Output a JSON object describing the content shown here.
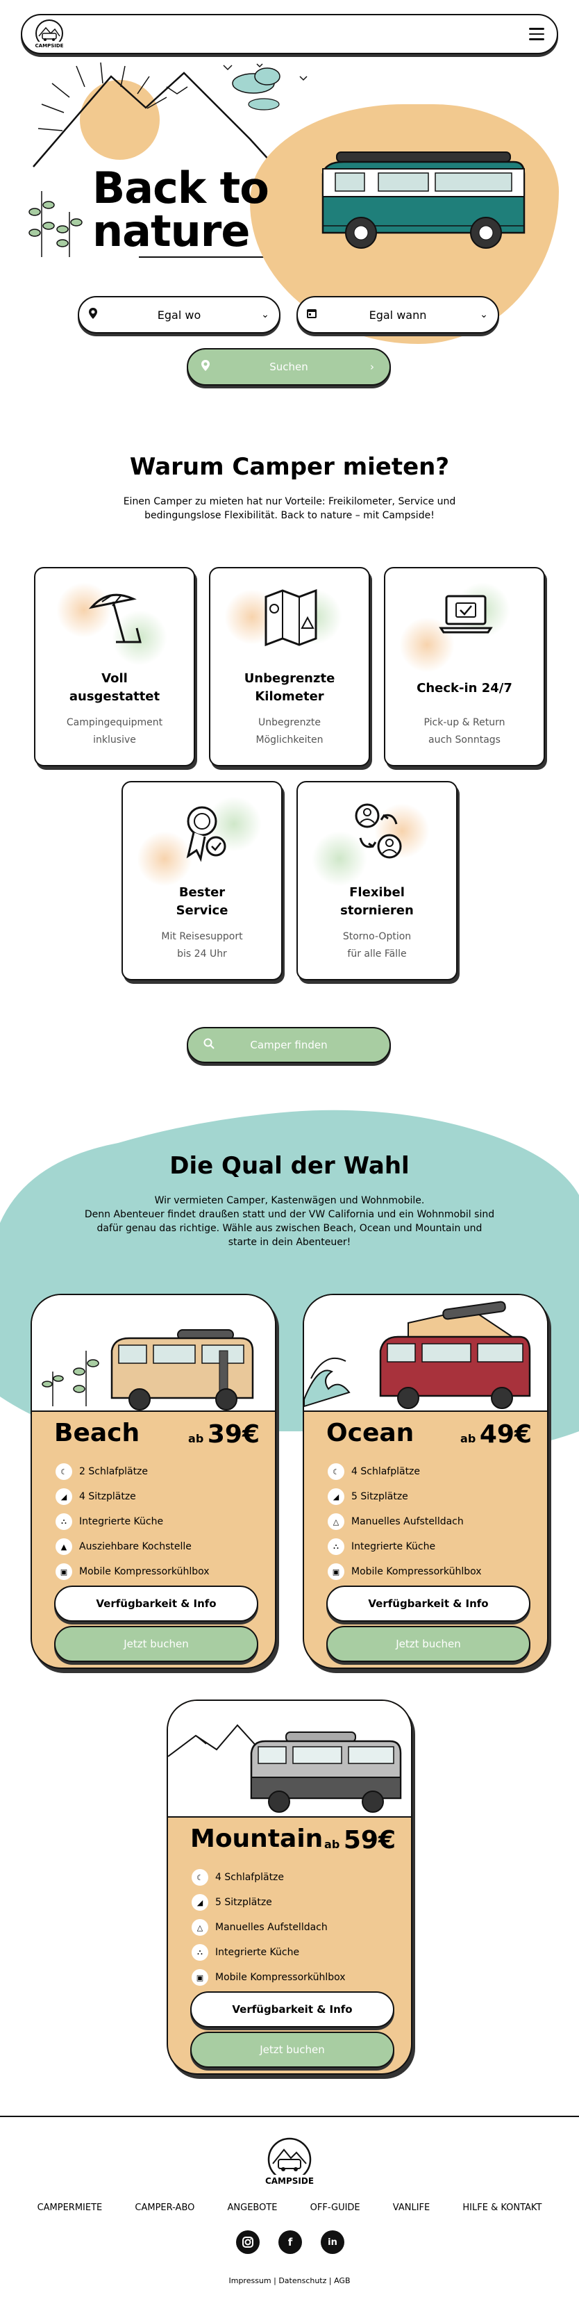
{
  "header": {
    "logo_text": "CAMPSIDE",
    "menu_icon": "hamburger-icon"
  },
  "hero": {
    "title_line1": "Back to",
    "title_line2": "nature",
    "where": {
      "label": "Egal wo",
      "icon": "location-pin-icon"
    },
    "when": {
      "label": "Egal wann",
      "icon": "calendar-icon"
    },
    "search_label": "Suchen"
  },
  "why": {
    "title": "Warum Camper mieten?",
    "intro_line1": "Einen Camper zu mieten hat nur Vorteile: Freikilometer, Service und",
    "intro_line2": "bedingungslose Flexibilität. Back to nature – mit Campside!",
    "features": [
      {
        "title1": "Voll",
        "title2": "ausgestattet",
        "desc1": "Campingequipment",
        "desc2": "inklusive",
        "icon": "beach-umbrella-icon"
      },
      {
        "title1": "Unbegrenzte",
        "title2": "Kilometer",
        "desc1": "Unbegrenzte",
        "desc2": "Möglichkeiten",
        "icon": "map-icon"
      },
      {
        "title1": "Check-in 24/7",
        "title2": "",
        "desc1": "Pick-up & Return",
        "desc2": "auch Sonntags",
        "icon": "laptop-check-icon"
      },
      {
        "title1": "Bester",
        "title2": "Service",
        "desc1": "Mit Reisesupport",
        "desc2": "bis 24 Uhr",
        "icon": "award-badge-icon"
      },
      {
        "title1": "Flexibel",
        "title2": "stornieren",
        "desc1": "Storno-Option",
        "desc2": "für alle Fälle",
        "icon": "swap-users-icon"
      }
    ],
    "find_label": "Camper finden"
  },
  "choice": {
    "title": "Die Qual der Wahl",
    "text_line1": "Wir vermieten Camper, Kastenwägen und Wohnmobile.",
    "text_line2": "Denn Abenteuer findet draußen statt und der VW California und ein Wohnmobil sind",
    "text_line3": "dafür genau das richtige. Wähle aus zwischen Beach, Ocean und Mountain und",
    "text_line4": "starte in dein Abenteuer!",
    "cards": [
      {
        "name": "Beach",
        "price_prefix": "ab",
        "price": "39€",
        "features": [
          "2 Schlafplätze",
          "4 Sitzplätze",
          "Integrierte Küche",
          "Ausziehbare Kochstelle",
          "Mobile Kompressorkühlbox"
        ],
        "info_label": "Verfügbarkeit & Info",
        "book_label": "Jetzt buchen"
      },
      {
        "name": "Ocean",
        "price_prefix": "ab",
        "price": "49€",
        "features": [
          "4 Schlafplätze",
          "5 Sitzplätze",
          "Manuelles Aufstelldach",
          "Integrierte Küche",
          "Mobile Kompressorkühlbox"
        ],
        "info_label": "Verfügbarkeit & Info",
        "book_label": "Jetzt buchen"
      },
      {
        "name": "Mountain",
        "price_prefix": "ab",
        "price": "59€",
        "features": [
          "4 Schlafplätze",
          "5 Sitzplätze",
          "Manuelles Aufstelldach",
          "Integrierte Küche",
          "Mobile Kompressorkühlbox"
        ],
        "info_label": "Verfügbarkeit & Info",
        "book_label": "Jetzt buchen"
      }
    ]
  },
  "footer": {
    "logo_text": "CAMPSIDE",
    "nav": [
      "CAMPERMIETE",
      "CAMPER-ABO",
      "ANGEBOTE",
      "OFF-GUIDE",
      "VANLIFE",
      "HILFE & KONTAKT"
    ],
    "social": [
      "instagram-icon",
      "facebook-icon",
      "linkedin-icon"
    ],
    "legal": "Impressum | Datenschutz | AGB"
  },
  "colors": {
    "accent_green": "#a8cda2",
    "sand": "#f0c993",
    "teal": "#a3d6d0",
    "van_teal": "#1f7f7a",
    "van_red": "#a8323c"
  }
}
